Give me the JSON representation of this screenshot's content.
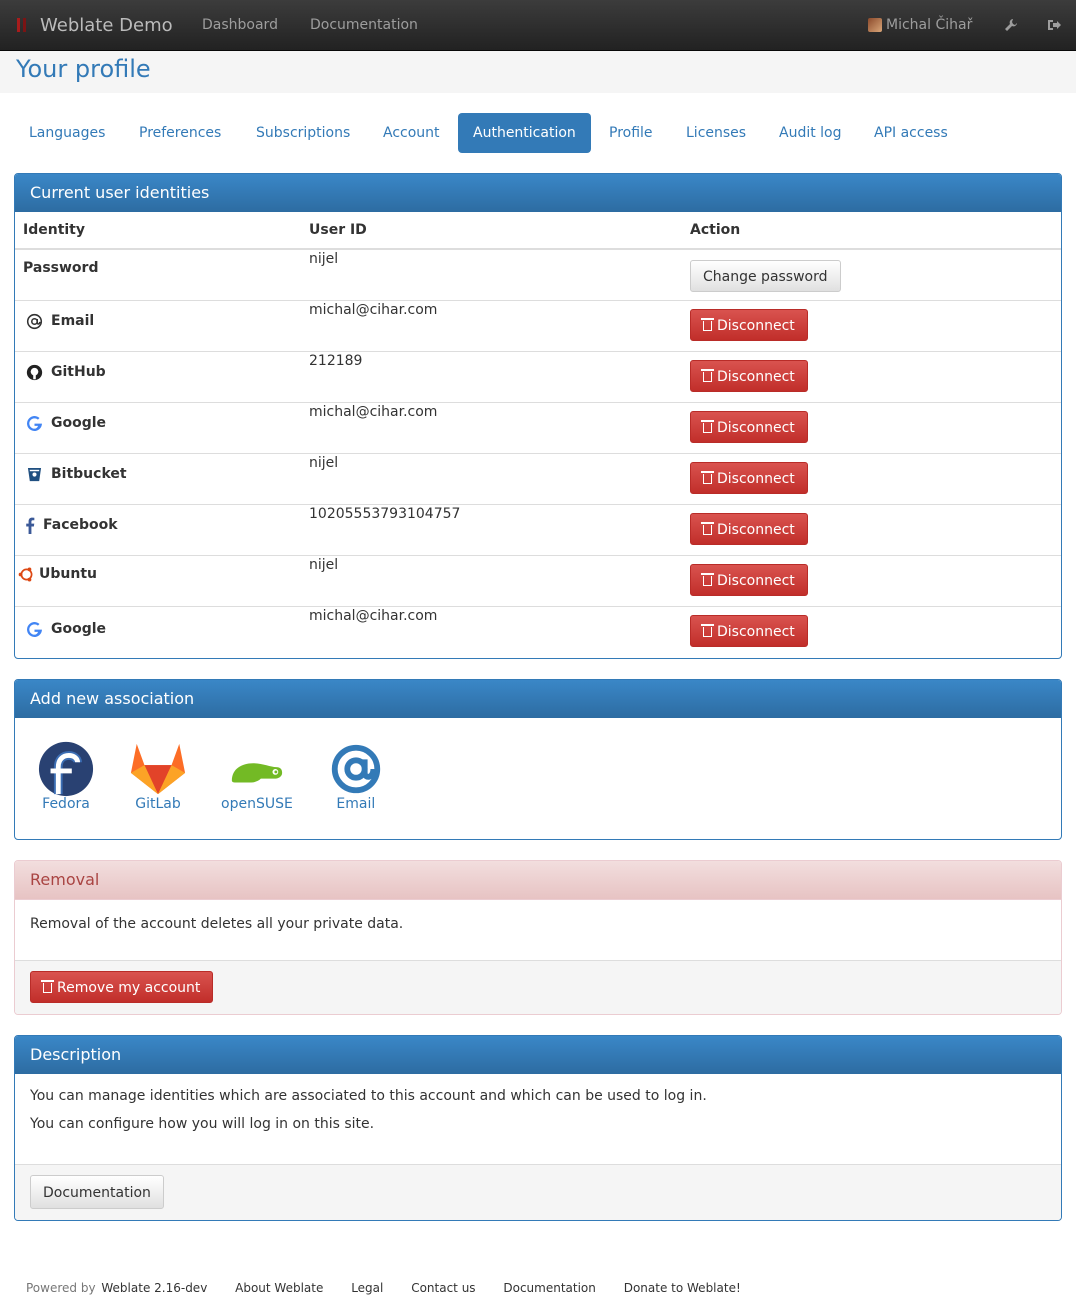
{
  "navbar": {
    "brand": "Weblate Demo",
    "links": [
      "Dashboard",
      "Documentation"
    ],
    "user": "Michal Čihař",
    "icons": [
      "wrench-icon",
      "logout-icon"
    ]
  },
  "page": {
    "title": "Your profile"
  },
  "tabs": [
    "Languages",
    "Preferences",
    "Subscriptions",
    "Account",
    "Authentication",
    "Profile",
    "Licenses",
    "Audit log",
    "API access"
  ],
  "active_tab": "Authentication",
  "identities": {
    "heading": "Current user identities",
    "columns": [
      "Identity",
      "User ID",
      "Action"
    ],
    "rows": [
      {
        "identity": "Password",
        "icon": "",
        "user_id": "nijel",
        "action": "Change password"
      },
      {
        "identity": "Email",
        "icon": "at-icon",
        "user_id": "michal@cihar.com",
        "action": "Disconnect"
      },
      {
        "identity": "GitHub",
        "icon": "github-icon",
        "user_id": "212189",
        "action": "Disconnect"
      },
      {
        "identity": "Google",
        "icon": "google-icon",
        "user_id": "michal@cihar.com",
        "action": "Disconnect"
      },
      {
        "identity": "Bitbucket",
        "icon": "bitbucket-icon",
        "user_id": "nijel",
        "action": "Disconnect"
      },
      {
        "identity": "Facebook",
        "icon": "facebook-icon",
        "user_id": "10205553793104757",
        "action": "Disconnect"
      },
      {
        "identity": "Ubuntu",
        "icon": "ubuntu-icon",
        "user_id": "nijel",
        "action": "Disconnect"
      },
      {
        "identity": "Google",
        "icon": "google-icon",
        "user_id": "michal@cihar.com",
        "action": "Disconnect"
      }
    ]
  },
  "association": {
    "heading": "Add new association",
    "providers": [
      {
        "name": "Fedora",
        "icon": "fedora-icon"
      },
      {
        "name": "GitLab",
        "icon": "gitlab-icon"
      },
      {
        "name": "openSUSE",
        "icon": "opensuse-icon"
      },
      {
        "name": "Email",
        "icon": "email-at-icon"
      }
    ]
  },
  "removal": {
    "heading": "Removal",
    "text": "Removal of the account deletes all your private data.",
    "button": "Remove my account"
  },
  "description": {
    "heading": "Description",
    "lines": [
      "You can manage identities which are associated to this account and which can be used to log in.",
      "You can configure how you will log in on this site."
    ],
    "button": "Documentation"
  },
  "footer": {
    "powered_by": "Powered by",
    "weblate_version": "Weblate 2.16-dev",
    "links": [
      "About Weblate",
      "Legal",
      "Contact us",
      "Documentation",
      "Donate to Weblate!"
    ]
  },
  "colors": {
    "primary": "#337ab7",
    "danger": "#d9534f",
    "navbar": "#222222"
  }
}
